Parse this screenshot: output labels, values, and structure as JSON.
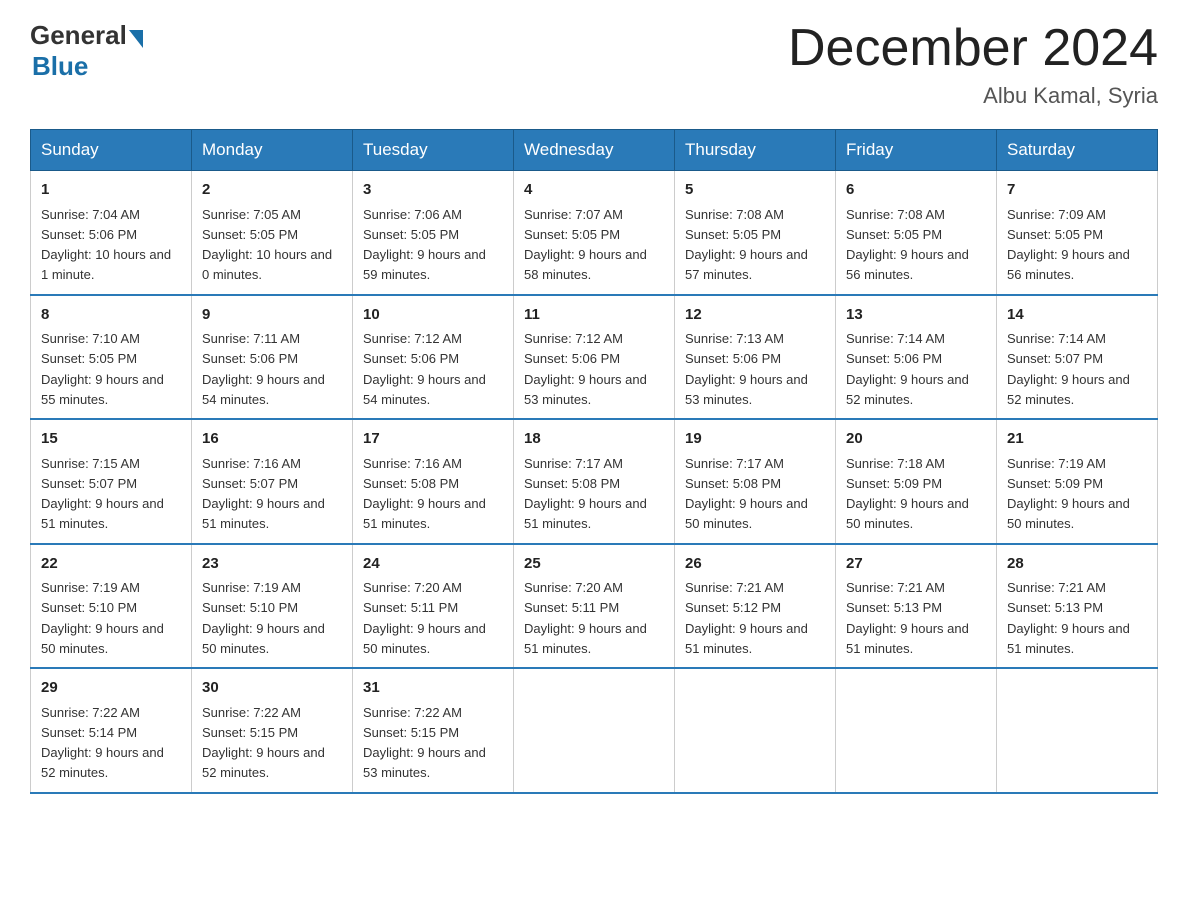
{
  "logo": {
    "text_general": "General",
    "text_blue": "Blue"
  },
  "title": "December 2024",
  "subtitle": "Albu Kamal, Syria",
  "days_of_week": [
    "Sunday",
    "Monday",
    "Tuesday",
    "Wednesday",
    "Thursday",
    "Friday",
    "Saturday"
  ],
  "weeks": [
    [
      {
        "day": "1",
        "sunrise": "7:04 AM",
        "sunset": "5:06 PM",
        "daylight": "10 hours and 1 minute."
      },
      {
        "day": "2",
        "sunrise": "7:05 AM",
        "sunset": "5:05 PM",
        "daylight": "10 hours and 0 minutes."
      },
      {
        "day": "3",
        "sunrise": "7:06 AM",
        "sunset": "5:05 PM",
        "daylight": "9 hours and 59 minutes."
      },
      {
        "day": "4",
        "sunrise": "7:07 AM",
        "sunset": "5:05 PM",
        "daylight": "9 hours and 58 minutes."
      },
      {
        "day": "5",
        "sunrise": "7:08 AM",
        "sunset": "5:05 PM",
        "daylight": "9 hours and 57 minutes."
      },
      {
        "day": "6",
        "sunrise": "7:08 AM",
        "sunset": "5:05 PM",
        "daylight": "9 hours and 56 minutes."
      },
      {
        "day": "7",
        "sunrise": "7:09 AM",
        "sunset": "5:05 PM",
        "daylight": "9 hours and 56 minutes."
      }
    ],
    [
      {
        "day": "8",
        "sunrise": "7:10 AM",
        "sunset": "5:05 PM",
        "daylight": "9 hours and 55 minutes."
      },
      {
        "day": "9",
        "sunrise": "7:11 AM",
        "sunset": "5:06 PM",
        "daylight": "9 hours and 54 minutes."
      },
      {
        "day": "10",
        "sunrise": "7:12 AM",
        "sunset": "5:06 PM",
        "daylight": "9 hours and 54 minutes."
      },
      {
        "day": "11",
        "sunrise": "7:12 AM",
        "sunset": "5:06 PM",
        "daylight": "9 hours and 53 minutes."
      },
      {
        "day": "12",
        "sunrise": "7:13 AM",
        "sunset": "5:06 PM",
        "daylight": "9 hours and 53 minutes."
      },
      {
        "day": "13",
        "sunrise": "7:14 AM",
        "sunset": "5:06 PM",
        "daylight": "9 hours and 52 minutes."
      },
      {
        "day": "14",
        "sunrise": "7:14 AM",
        "sunset": "5:07 PM",
        "daylight": "9 hours and 52 minutes."
      }
    ],
    [
      {
        "day": "15",
        "sunrise": "7:15 AM",
        "sunset": "5:07 PM",
        "daylight": "9 hours and 51 minutes."
      },
      {
        "day": "16",
        "sunrise": "7:16 AM",
        "sunset": "5:07 PM",
        "daylight": "9 hours and 51 minutes."
      },
      {
        "day": "17",
        "sunrise": "7:16 AM",
        "sunset": "5:08 PM",
        "daylight": "9 hours and 51 minutes."
      },
      {
        "day": "18",
        "sunrise": "7:17 AM",
        "sunset": "5:08 PM",
        "daylight": "9 hours and 51 minutes."
      },
      {
        "day": "19",
        "sunrise": "7:17 AM",
        "sunset": "5:08 PM",
        "daylight": "9 hours and 50 minutes."
      },
      {
        "day": "20",
        "sunrise": "7:18 AM",
        "sunset": "5:09 PM",
        "daylight": "9 hours and 50 minutes."
      },
      {
        "day": "21",
        "sunrise": "7:19 AM",
        "sunset": "5:09 PM",
        "daylight": "9 hours and 50 minutes."
      }
    ],
    [
      {
        "day": "22",
        "sunrise": "7:19 AM",
        "sunset": "5:10 PM",
        "daylight": "9 hours and 50 minutes."
      },
      {
        "day": "23",
        "sunrise": "7:19 AM",
        "sunset": "5:10 PM",
        "daylight": "9 hours and 50 minutes."
      },
      {
        "day": "24",
        "sunrise": "7:20 AM",
        "sunset": "5:11 PM",
        "daylight": "9 hours and 50 minutes."
      },
      {
        "day": "25",
        "sunrise": "7:20 AM",
        "sunset": "5:11 PM",
        "daylight": "9 hours and 51 minutes."
      },
      {
        "day": "26",
        "sunrise": "7:21 AM",
        "sunset": "5:12 PM",
        "daylight": "9 hours and 51 minutes."
      },
      {
        "day": "27",
        "sunrise": "7:21 AM",
        "sunset": "5:13 PM",
        "daylight": "9 hours and 51 minutes."
      },
      {
        "day": "28",
        "sunrise": "7:21 AM",
        "sunset": "5:13 PM",
        "daylight": "9 hours and 51 minutes."
      }
    ],
    [
      {
        "day": "29",
        "sunrise": "7:22 AM",
        "sunset": "5:14 PM",
        "daylight": "9 hours and 52 minutes."
      },
      {
        "day": "30",
        "sunrise": "7:22 AM",
        "sunset": "5:15 PM",
        "daylight": "9 hours and 52 minutes."
      },
      {
        "day": "31",
        "sunrise": "7:22 AM",
        "sunset": "5:15 PM",
        "daylight": "9 hours and 53 minutes."
      },
      null,
      null,
      null,
      null
    ]
  ]
}
